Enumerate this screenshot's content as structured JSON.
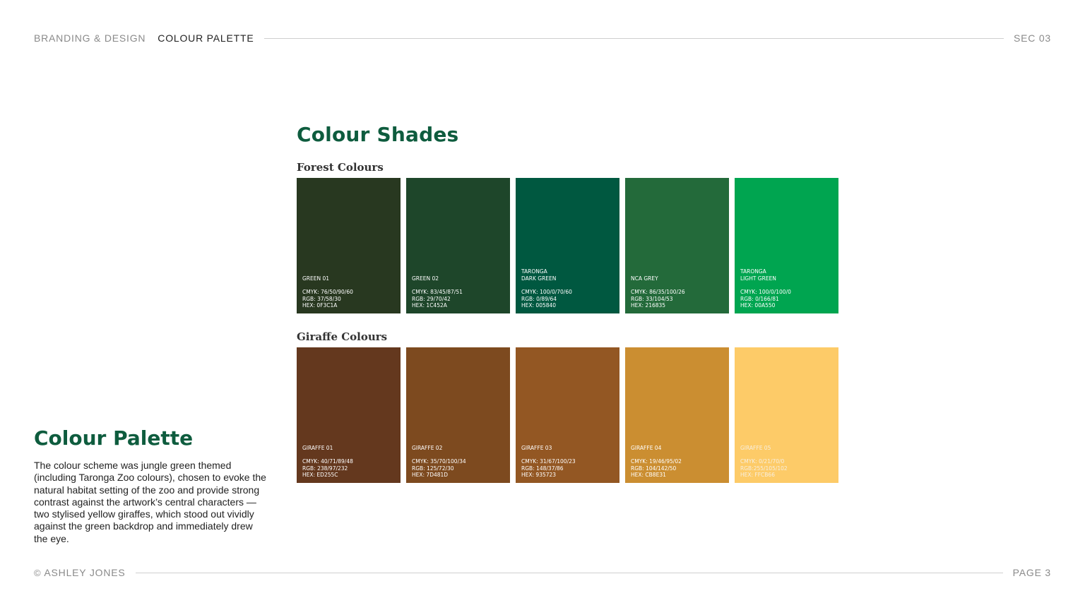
{
  "header": {
    "section": "BRANDING & DESIGN",
    "current": "COLOUR PALETTE",
    "sec_label": "SEC 03"
  },
  "footer": {
    "copyright_symbol": "©",
    "author": "ASHLEY JONES",
    "page": "PAGE 3"
  },
  "main_title": "Colour Shades",
  "groups": {
    "forest": {
      "title": "Forest Colours",
      "swatches": [
        {
          "name": "GREEN 01",
          "cmyk": "CMYK: 76/50/90/60",
          "rgb": "RGB: 37/58/30",
          "hex": "HEX: 0F3C1A",
          "color": "#283820",
          "text_color": "#ffffff"
        },
        {
          "name": "GREEN 02",
          "cmyk": "CMYK: 83/45/87/51",
          "rgb": "RGB: 29/70/42",
          "hex": "HEX: 1C452A",
          "color": "#1e462a",
          "text_color": "#ffffff"
        },
        {
          "name": "TARONGA\nDARK GREEN",
          "cmyk": "CMYK: 100/0/70/60",
          "rgb": "RGB: 0/89/64",
          "hex": "HEX: 005840",
          "color": "#005840",
          "text_color": "#ffffff"
        },
        {
          "name": "NCA GREY",
          "cmyk": "CMYK: 86/35/100/26",
          "rgb": "RGB: 33/104/53",
          "hex": "HEX: 216835",
          "color": "#236a3a",
          "text_color": "#ffffff"
        },
        {
          "name": "TARONGA\nLIGHT GREEN",
          "cmyk": "CMYK: 100/0/100/0",
          "rgb": "RGB: 0/166/81",
          "hex": "HEX: 00A550",
          "color": "#00a550",
          "text_color": "#ffffff"
        }
      ]
    },
    "giraffe": {
      "title": "Giraffe Colours",
      "swatches": [
        {
          "name": "GIRAFFE 01",
          "cmyk": "CMYK: 40/71/89/48",
          "rgb": "RGB: 238/97/232",
          "hex": "HEX: ED255C",
          "color": "#64381e",
          "text_color": "#ffffff"
        },
        {
          "name": "GIRAFFE 02",
          "cmyk": "CMYK: 35/70/100/34",
          "rgb": "RGB: 125/72/30",
          "hex": "HEX: 7D481D",
          "color": "#7d4a1f",
          "text_color": "#ffffff"
        },
        {
          "name": "GIRAFFE 03",
          "cmyk": "CMYK: 31/67/100/23",
          "rgb": "RGB: 148/37/86",
          "hex": "HEX: 935723",
          "color": "#935723",
          "text_color": "#ffffff"
        },
        {
          "name": "GIRAFFE 04",
          "cmyk": "CMYK: 19/46/95/02",
          "rgb": "RGB: 104/142/50",
          "hex": "HEX: CB8E31",
          "color": "#cb8e31",
          "text_color": "#ffffff"
        },
        {
          "name": "GIRAFFE 05",
          "cmyk": "CMYK: 0/21/70/0",
          "rgb": "RGB:255/105/102",
          "hex": "HEX: FFCB66",
          "color": "#fdcb68",
          "text_color": "#f7efe0"
        }
      ]
    }
  },
  "side": {
    "title": "Colour Palette",
    "description": "The colour scheme was jungle green themed (including Taronga Zoo colours), chosen to evoke the natural habitat setting of the zoo and provide strong contrast against the artwork’s central characters — two stylised yellow giraffes, which stood out vividly against the green backdrop and immediately drew the eye."
  },
  "brand_colors": {
    "heading_green": "#0e5c3e",
    "rule_grey": "#cfcfcf",
    "meta_grey": "#8a8a8a"
  }
}
